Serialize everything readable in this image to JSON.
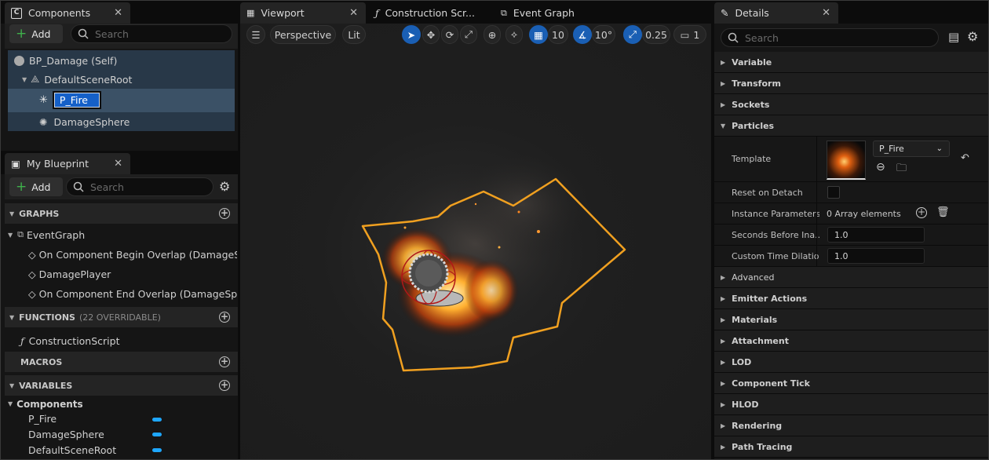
{
  "components_panel": {
    "tab_label": "Components",
    "add_label": "Add",
    "search_placeholder": "Search",
    "tree": [
      {
        "label": "BP_Damage (Self)"
      },
      {
        "label": "DefaultSceneRoot"
      },
      {
        "label": "P_Fire"
      },
      {
        "label": "DamageSphere"
      }
    ]
  },
  "blueprint_panel": {
    "tab_label": "My Blueprint",
    "add_label": "Add",
    "search_placeholder": "Search",
    "graphs_header": "GRAPHS",
    "graphs": {
      "name": "EventGraph",
      "events": [
        "On Component Begin Overlap (DamageSphe",
        "DamagePlayer",
        "On Component End Overlap (DamageSpher"
      ]
    },
    "functions_header": "FUNCTIONS",
    "functions_count": "(22 OVERRIDABLE)",
    "functions": [
      "ConstructionScript"
    ],
    "macros_header": "MACROS",
    "variables_header": "VARIABLES",
    "variables_group": "Components",
    "variables": [
      "P_Fire",
      "DamageSphere",
      "DefaultSceneRoot"
    ]
  },
  "viewport": {
    "tabs": [
      {
        "label": "Viewport"
      },
      {
        "label": "Construction Scr..."
      },
      {
        "label": "Event Graph"
      }
    ],
    "perspective_label": "Perspective",
    "lit_label": "Lit",
    "grid_snap": "10",
    "rotation_snap": "10°",
    "scale_snap": "0.25",
    "camera_speed": "1"
  },
  "details": {
    "tab_label": "Details",
    "search_placeholder": "Search",
    "categories_top": [
      "Variable",
      "Transform",
      "Sockets",
      "Particles"
    ],
    "template_label": "Template",
    "template_value": "P_Fire",
    "reset_on_detach_label": "Reset on Detach",
    "instance_params_label": "Instance Parameters",
    "instance_params_value": "0 Array elements",
    "seconds_before_label": "Seconds Before Ina...",
    "seconds_before_value": "1.0",
    "custom_time_label": "Custom Time Dilation",
    "custom_time_value": "1.0",
    "categories_bottom": [
      "Advanced",
      "Emitter Actions",
      "Materials",
      "Attachment",
      "LOD",
      "Component Tick",
      "HLOD",
      "Rendering",
      "Path Tracing"
    ]
  },
  "colors": {
    "accent_blue": "#1a5fb4",
    "selection_orange": "#f0a020",
    "variable_blue": "#1ea7ff",
    "add_green": "#3fb04b"
  }
}
